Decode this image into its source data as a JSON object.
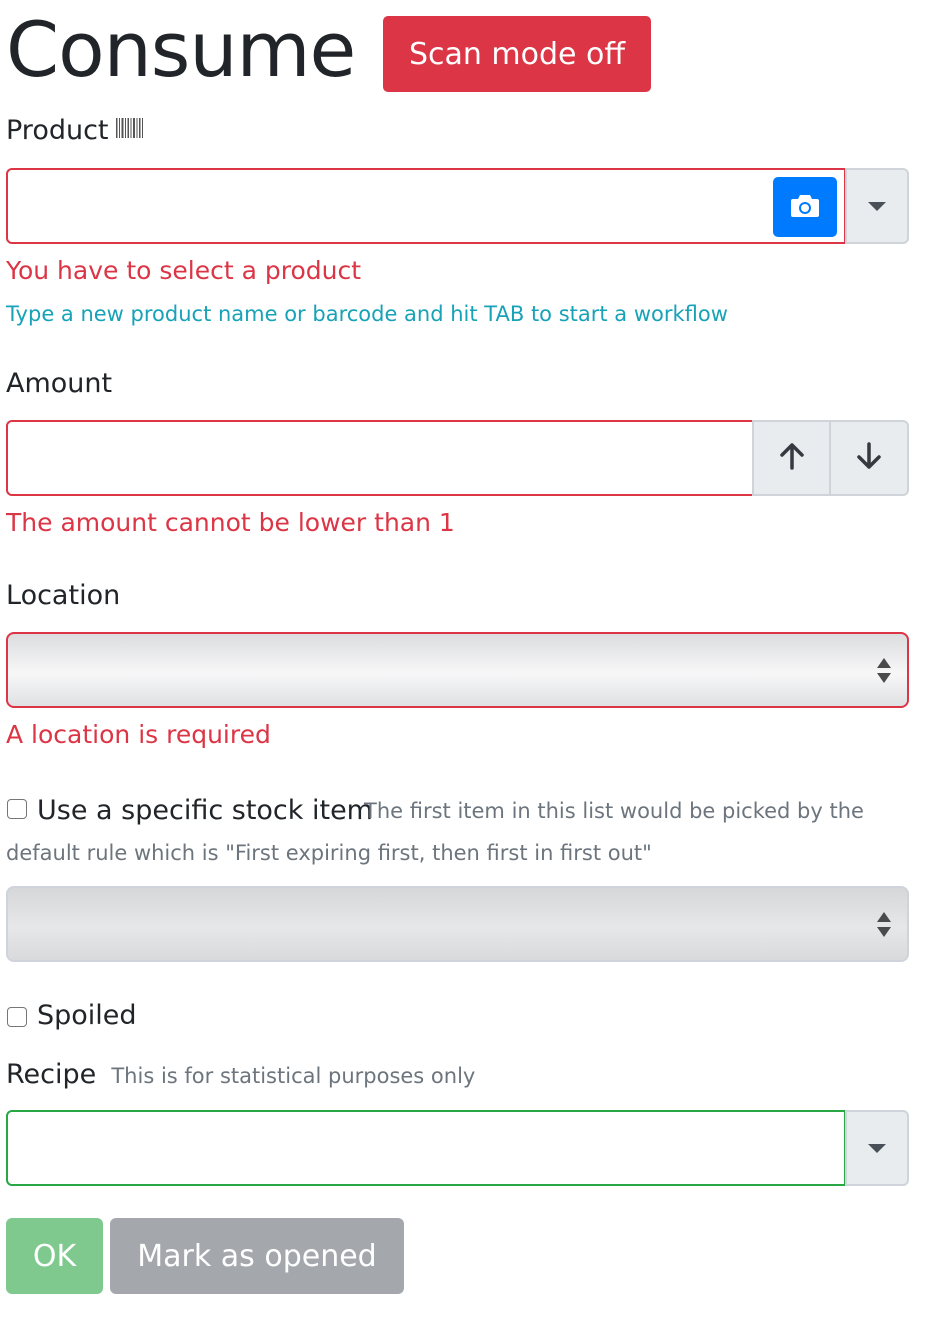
{
  "header": {
    "title": "Consume",
    "scan_mode_label": "Scan mode off"
  },
  "product": {
    "label": "Product",
    "value": "",
    "error": "You have to select a product",
    "hint": "Type a new product name or barcode and hit TAB to start a workflow",
    "icons": [
      "barcode-icon",
      "camera-icon",
      "caret-down-icon"
    ]
  },
  "amount": {
    "label": "Amount",
    "value": "",
    "error": "The amount cannot be lower than 1",
    "icons": [
      "arrow-up-icon",
      "arrow-down-icon"
    ]
  },
  "location": {
    "label": "Location",
    "selected": "",
    "error": "A location is required"
  },
  "specific_stock": {
    "label": "Use a specific stock item",
    "help": "The first item in this list would be picked by the default rule which is \"First expiring first, then first in first out\"",
    "checked": false,
    "selected": ""
  },
  "spoiled": {
    "label": "Spoiled",
    "checked": false
  },
  "recipe": {
    "label": "Recipe",
    "help": "This is for statistical purposes only",
    "value": ""
  },
  "actions": {
    "ok_label": "OK",
    "mark_opened_label": "Mark as opened"
  },
  "colors": {
    "danger": "#dc3545",
    "primary": "#007bff",
    "info": "#17a2b8",
    "success": "#28a745",
    "secondary": "#6c757d"
  }
}
